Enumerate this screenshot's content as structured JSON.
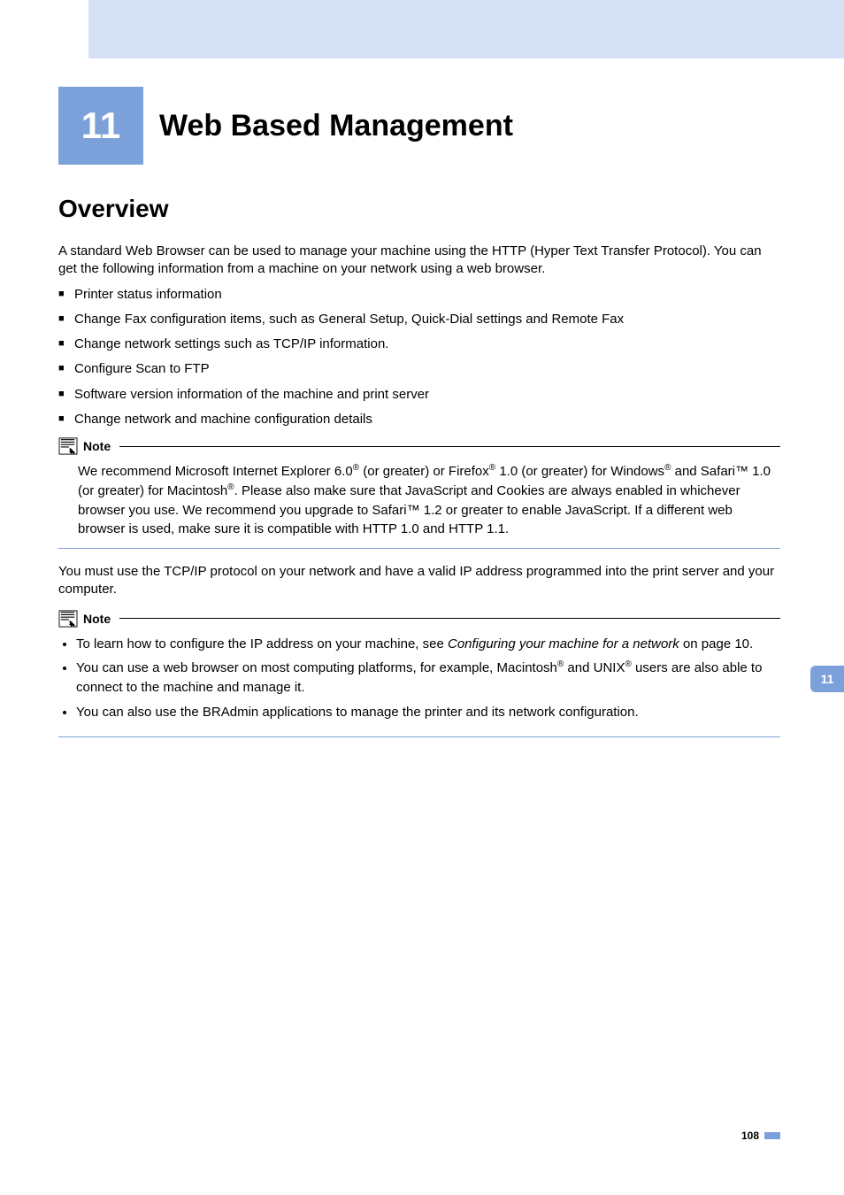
{
  "chapter": {
    "number": "11",
    "title": "Web Based Management"
  },
  "section_heading": "Overview",
  "intro_p1": "A standard Web Browser can be used to manage your machine using the HTTP (Hyper Text Transfer Protocol). You can get the following information from a machine on your network using a web browser.",
  "bullets": [
    "Printer status information",
    "Change Fax configuration items, such as General Setup, Quick-Dial settings and Remote Fax",
    "Change network settings such as TCP/IP information.",
    "Configure Scan to FTP",
    "Software version information of the machine and print server",
    "Change network and machine configuration details"
  ],
  "note1_label": "Note",
  "note1_html": "We recommend Microsoft Internet Explorer 6.0<sup>®</sup> (or greater) or Firefox<sup>®</sup> 1.0 (or greater) for Windows<sup>®</sup> and Safari™ 1.0 (or greater) for Macintosh<sup>®</sup>. Please also make sure that JavaScript and Cookies are always enabled in whichever browser you use. We recommend you upgrade to Safari™ 1.2 or greater to enable JavaScript. If a different web browser is used, make sure it is compatible with HTTP 1.0 and HTTP 1.1.",
  "mid_p": "You must use the TCP/IP protocol on your network and have a valid IP address programmed into the print server and your computer.",
  "note2_label": "Note",
  "note2_items": [
    "To learn how to configure the IP address on your machine, see <span class='link'>Configuring your machine for a network</span> on page 10.",
    "You can use a web browser on most computing platforms, for example, Macintosh<sup>®</sup> and UNIX<sup>®</sup> users are also able to connect to the machine and manage it.",
    "You can also use the BRAdmin applications to manage the printer and its network configuration."
  ],
  "side_tab": "11",
  "page_number": "108"
}
